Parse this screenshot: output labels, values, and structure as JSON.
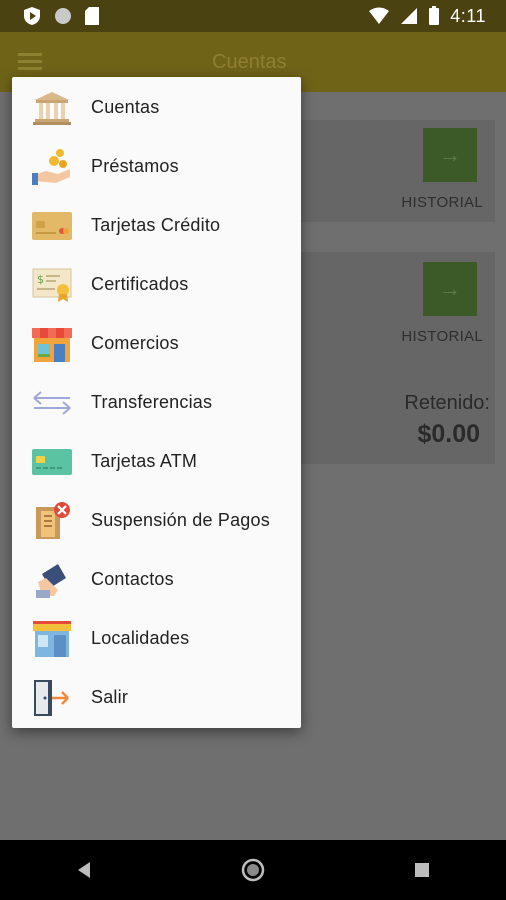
{
  "status": {
    "time": "4:11"
  },
  "app_bar": {
    "title": "Cuentas"
  },
  "background": {
    "card1": {
      "history_label": "HISTORIAL"
    },
    "card2": {
      "history_label": "HISTORIAL",
      "retained_label": "Retenido:",
      "retained_value": "$0.00"
    }
  },
  "drawer": {
    "items": [
      {
        "label": "Cuentas",
        "icon": "bank-icon"
      },
      {
        "label": "Préstamos",
        "icon": "loan-coins-icon"
      },
      {
        "label": "Tarjetas Crédito",
        "icon": "credit-card-icon"
      },
      {
        "label": "Certificados",
        "icon": "certificate-icon"
      },
      {
        "label": "Comercios",
        "icon": "store-icon"
      },
      {
        "label": "Transferencias",
        "icon": "transfer-arrows-icon"
      },
      {
        "label": "Tarjetas ATM",
        "icon": "atm-card-icon"
      },
      {
        "label": "Suspensión de Pagos",
        "icon": "payment-suspension-icon"
      },
      {
        "label": "Contactos",
        "icon": "contacts-phone-icon"
      },
      {
        "label": "Localidades",
        "icon": "locations-building-icon"
      },
      {
        "label": "Salir",
        "icon": "exit-door-icon"
      }
    ]
  },
  "colors": {
    "status_bar": "#4a4210",
    "app_bar": "#6f6318",
    "drawer_bg": "#fafafa",
    "history_button": "#3c5a28"
  }
}
